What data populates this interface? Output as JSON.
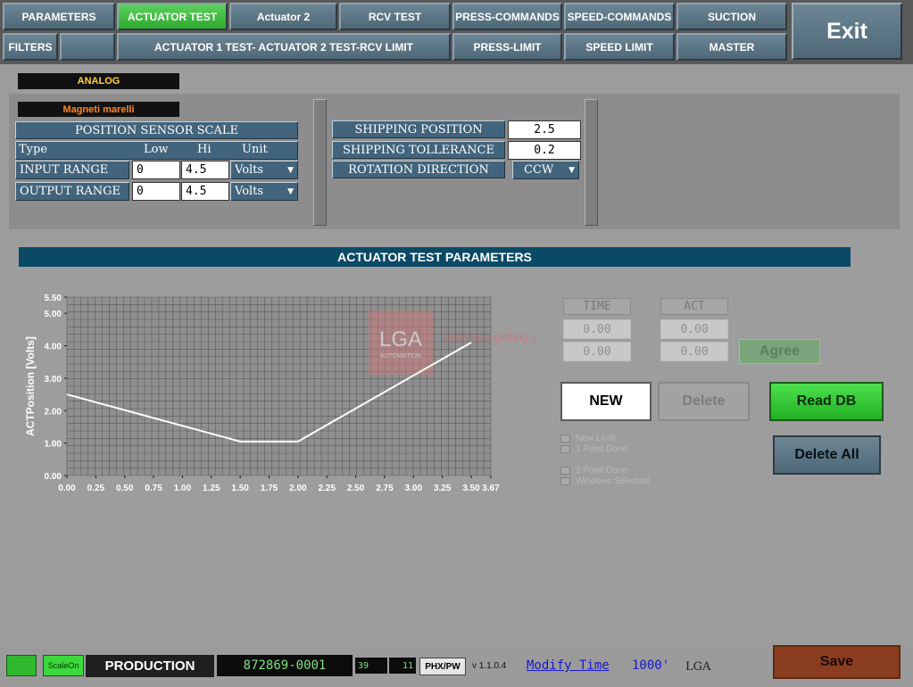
{
  "tabs_row1": [
    "PARAMETERS",
    "ACTUATOR TEST",
    "Actuator 2",
    "RCV TEST",
    "PRESS-COMMANDS",
    "SPEED-COMMANDS",
    "SUCTION"
  ],
  "tabs_row2": [
    "FILTERS",
    "",
    "ACTUATOR 1 TEST- ACTUATOR 2 TEST-RCV LIMIT",
    "PRESS-LIMIT",
    "SPEED LIMIT",
    "MASTER"
  ],
  "exit_label": "Exit",
  "sensor": {
    "type_tag": "ANALOG",
    "brand_tag": "Magneti marelli",
    "title": "POSITION SENSOR SCALE",
    "col_type": "Type",
    "col_low": "Low",
    "col_hi": "Hi",
    "col_unit": "Unit",
    "input_label": "INPUT RANGE",
    "input_low": "0",
    "input_hi": "4.5",
    "input_unit": "Volts",
    "output_label": "OUTPUT RANGE",
    "output_low": "0",
    "output_hi": "4.5",
    "output_unit": "Volts"
  },
  "shipping": {
    "position_label": "SHIPPING POSITION",
    "position_value": "2.5",
    "tolerance_label": "SHIPPING TOLLERANCE",
    "tolerance_value": "0.2",
    "rotation_label": "ROTATION DIRECTION",
    "rotation_value": "CCW"
  },
  "section_title": "ACTUATOR TEST PARAMETERS",
  "chart_data": {
    "type": "line",
    "ylabel": "ACTPosition [Volts]",
    "xlabel": "",
    "x_ticks": [
      "0.00",
      "0.25",
      "0.50",
      "0.75",
      "1.00",
      "1.25",
      "1.50",
      "1.75",
      "2.00",
      "2.25",
      "2.50",
      "2.75",
      "3.00",
      "3.25",
      "3.50",
      "3.67"
    ],
    "y_ticks": [
      "0.00",
      "1.00",
      "2.00",
      "3.00",
      "4.00",
      "5.00",
      "5.50"
    ],
    "xlim": [
      0,
      3.67
    ],
    "ylim": [
      0,
      5.5
    ],
    "grid": true,
    "series": [
      {
        "x": [
          0,
          1.5,
          2.0,
          3.5
        ],
        "y": [
          2.5,
          1.05,
          1.05,
          4.1
        ]
      }
    ],
    "line_color": "#ffffff",
    "watermark": {
      "logo": "LGA",
      "subtitle": "AUTOMATION",
      "tagline": "Lead you getting your aim."
    }
  },
  "points_table": {
    "time_header": "TIME",
    "act_header": "ACT",
    "rows": [
      {
        "time": "0.00",
        "act": "0.00"
      },
      {
        "time": "0.00",
        "act": "0.00"
      }
    ]
  },
  "buttons": {
    "agree": "Agree",
    "new": "NEW",
    "delete": "Delete",
    "read_db": "Read DB",
    "delete_all": "Delete All",
    "save": "Save"
  },
  "checks": {
    "new_limit": "New Limit",
    "one_point": "1 Point Done",
    "two_point": "2 Point Done",
    "windows_selected": "Windows Selected"
  },
  "status": {
    "scale_on": "ScaleOn",
    "mode": "PRODUCTION",
    "serial": "872869-0001",
    "num1": "39",
    "num2": "11",
    "badge": "PHX/PW",
    "version": "v 1.1.0.4",
    "modify_link": "Modify Time",
    "modify_value": "1000'",
    "company": "LGA"
  },
  "colors": {
    "accent_green": "#2ec82e",
    "tab_blue": "#56707f",
    "label_blue": "#42647c",
    "save_brown": "#8a3d1e",
    "title_bar": "#0a4a66"
  }
}
